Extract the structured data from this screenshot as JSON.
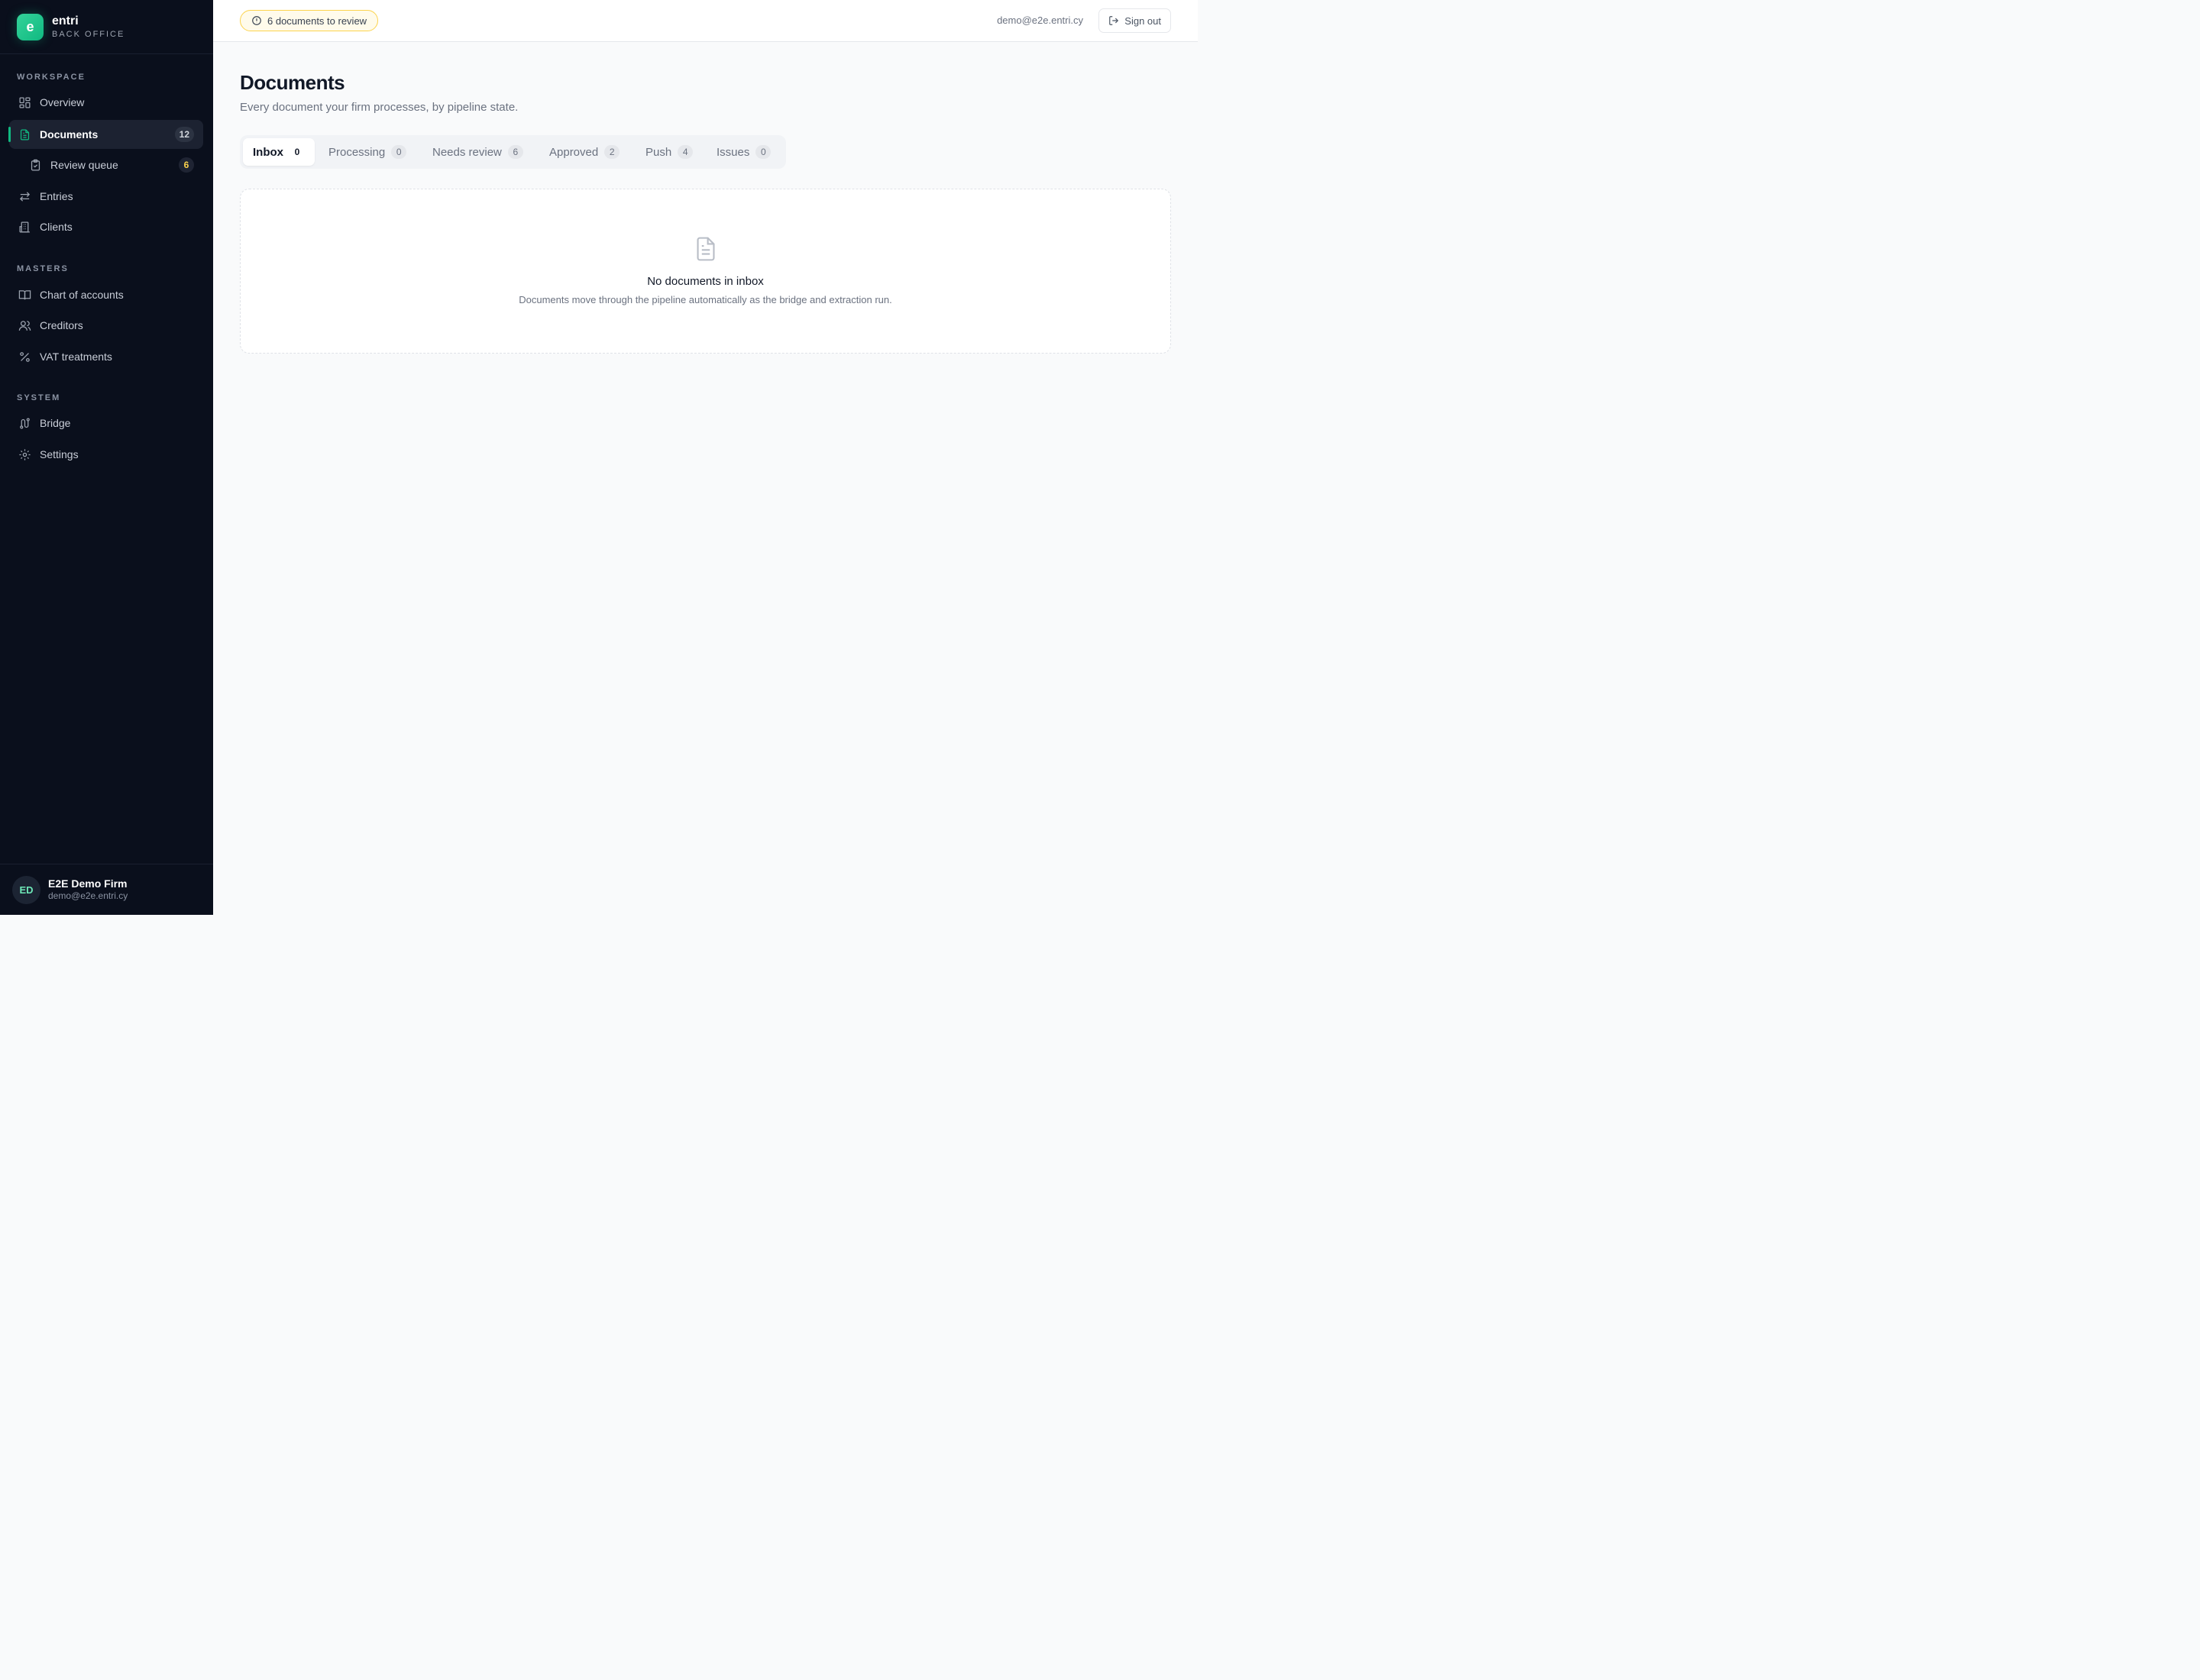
{
  "brand": {
    "logo_letter": "e",
    "name": "entri",
    "subtitle": "BACK OFFICE"
  },
  "sidebar": {
    "sections": [
      {
        "label": "WORKSPACE"
      },
      {
        "label": "MASTERS"
      },
      {
        "label": "SYSTEM"
      }
    ],
    "items": [
      {
        "label": "Overview",
        "icon": "grid-icon"
      },
      {
        "label": "Documents",
        "icon": "document-icon",
        "badge": "12",
        "active": true
      },
      {
        "label": "Review queue",
        "icon": "clipboard-check-icon",
        "badge": "6"
      },
      {
        "label": "Entries",
        "icon": "arrows-swap-icon"
      },
      {
        "label": "Clients",
        "icon": "building-icon"
      },
      {
        "label": "Chart of accounts",
        "icon": "book-icon"
      },
      {
        "label": "Creditors",
        "icon": "users-icon"
      },
      {
        "label": "VAT treatments",
        "icon": "percent-icon"
      },
      {
        "label": "Bridge",
        "icon": "route-icon"
      },
      {
        "label": "Settings",
        "icon": "gear-icon"
      }
    ],
    "footer": {
      "initials": "ED",
      "firm": "E2E Demo Firm",
      "email": "demo@e2e.entri.cy"
    }
  },
  "topbar": {
    "review_notice": "6 documents to review",
    "user_email": "demo@e2e.entri.cy",
    "signout_label": "Sign out"
  },
  "main": {
    "title": "Documents",
    "subtitle": "Every document your firm processes, by pipeline state.",
    "tabs": [
      {
        "label": "Inbox",
        "count": "0",
        "active": true
      },
      {
        "label": "Processing",
        "count": "0"
      },
      {
        "label": "Needs review",
        "count": "6"
      },
      {
        "label": "Approved",
        "count": "2"
      },
      {
        "label": "Push",
        "count": "4"
      },
      {
        "label": "Issues",
        "count": "0"
      }
    ],
    "empty": {
      "title": "No documents in inbox",
      "description": "Documents move through the pipeline automatically as the bridge and extraction run."
    }
  },
  "colors": {
    "accent": "#10b981",
    "sidebar_bg": "#0a0f1c",
    "warning": "#fcd34d"
  }
}
